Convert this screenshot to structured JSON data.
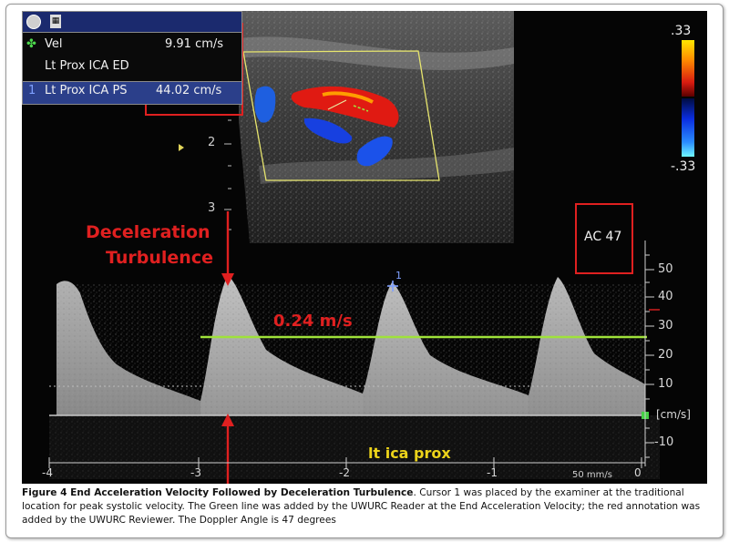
{
  "info_box": {
    "row1_label": "Vel",
    "row1_value": "9.91 cm/s",
    "row2_label": "Lt Prox ICA ED",
    "row3_index": "1",
    "row3_label": "Lt Prox ICA PS",
    "row3_value": "44.02 cm/s"
  },
  "color_scale": {
    "top": ".33",
    "bottom": "-.33"
  },
  "annotations": {
    "deceleration_line1": "Deceleration",
    "deceleration_line2": "Turbulence",
    "velocity_label": "0.24 m/s",
    "ac_label": "AC 47",
    "cursor_label": "1",
    "vessel_label": "lt ica prox",
    "sweep_speed": "50 mm/s"
  },
  "depth_scale": [
    "2",
    "3"
  ],
  "velocity_axis": {
    "ticks": [
      "50",
      "40",
      "30",
      "20",
      "10",
      "[cm/s]",
      "-10"
    ],
    "unit": "cm/s"
  },
  "time_axis": [
    "-4",
    "-3",
    "-2",
    "-1",
    "0"
  ],
  "colors": {
    "annotation_red": "#e02020",
    "green_line": "#9fe23a",
    "cursor_blue": "#7fa0ff",
    "vessel_yellow": "#f2e600"
  },
  "caption": {
    "bold": "Figure 4 End Acceleration Velocity Followed by Deceleration Turbulence",
    "text": ". Cursor 1 was placed by the examiner at the traditional location for peak systolic velocity. The Green line was added by the UWURC Reader at the End Acceleration Velocity; the red annotation was added by the UWURC Reviewer. The Doppler Angle is 47 degrees"
  }
}
